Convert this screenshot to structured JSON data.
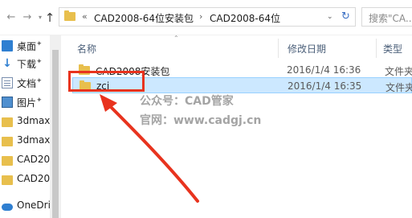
{
  "nav": {
    "back_glyph": "←",
    "forward_glyph": "→",
    "recent_glyph": "▾",
    "up_glyph": "↑"
  },
  "address": {
    "overflow": "«",
    "crumbs": [
      "CAD2008-64位安装包",
      "CAD2008-64位"
    ],
    "separator": "›",
    "dropdown_glyph": "⌄",
    "refresh_glyph": "↻"
  },
  "search": {
    "placeholder": "搜索\"CA..."
  },
  "sidebar": {
    "items": [
      {
        "label": "桌面",
        "icon": "desktop-icon",
        "pinned": true
      },
      {
        "label": "下载",
        "icon": "download-icon",
        "pinned": true
      },
      {
        "label": "文档",
        "icon": "document-icon",
        "pinned": true
      },
      {
        "label": "图片",
        "icon": "picture-icon",
        "pinned": true
      },
      {
        "label": "3dmax",
        "icon": "folder-icon",
        "pinned": false
      },
      {
        "label": "3dmax",
        "icon": "folder-icon",
        "pinned": false
      },
      {
        "label": "CAD20",
        "icon": "folder-icon",
        "pinned": false
      },
      {
        "label": "CAD20",
        "icon": "folder-icon",
        "pinned": false
      },
      {
        "label": "OneDriv",
        "icon": "onedrive-icon",
        "pinned": false
      }
    ],
    "pin_glyph": "✦"
  },
  "columns": {
    "name": "名称",
    "modified": "修改日期",
    "type": "类型"
  },
  "files": [
    {
      "name": "CAD2008安装包",
      "modified": "2016/1/4 16:36",
      "type": "文件夹",
      "selected": false
    },
    {
      "name": "zcj",
      "modified": "2016/1/4 16:35",
      "type": "文件夹",
      "selected": true
    }
  ],
  "watermark": {
    "line1": "公众号：CAD管家",
    "line2": "官网：www.cadgj.cn"
  },
  "colors": {
    "accent": "#e8331e",
    "selection": "#cce8ff",
    "folder": "#e8bf4d"
  }
}
